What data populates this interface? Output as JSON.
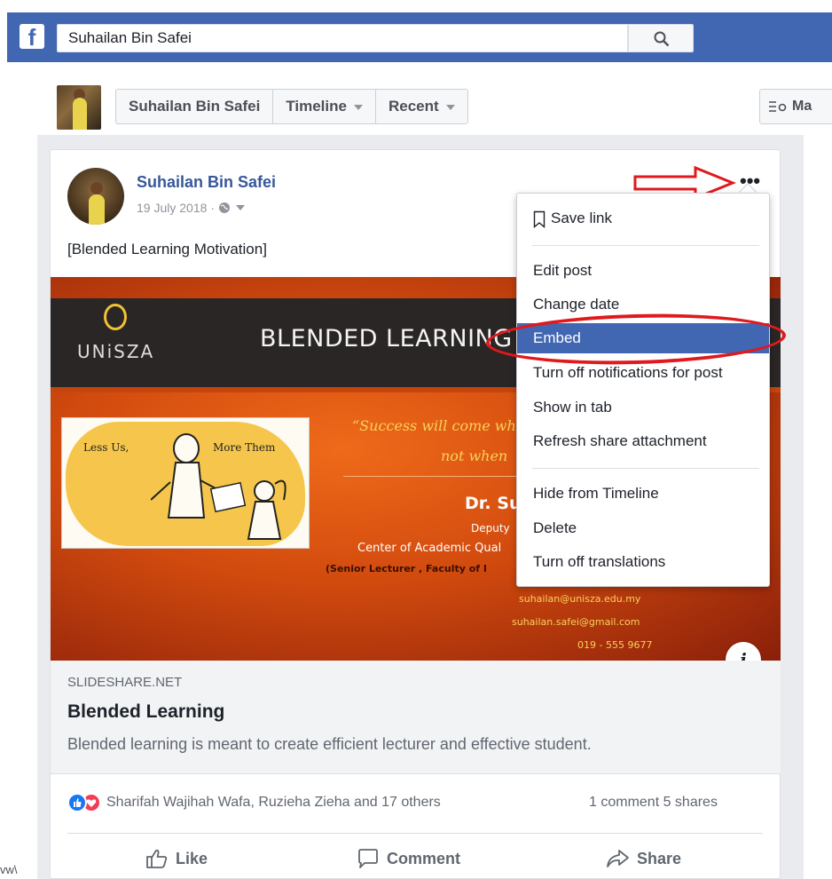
{
  "header": {
    "logo": "f",
    "search_value": "Suhailan Bin Safei",
    "search_icon": "search-icon"
  },
  "subbar": {
    "pills": [
      "Suhailan Bin Safei",
      "Timeline",
      "Recent"
    ],
    "manage_label": "Ma"
  },
  "post": {
    "author": "Suhailan Bin Safei",
    "date": "19 July 2018",
    "meta_separator": "·",
    "text": "[Blended Learning Motivation]",
    "more_icon": "•••"
  },
  "slide": {
    "logo_text": "UNiSZA",
    "title": "BLENDED LEARNING",
    "illus_left": "Less Us,",
    "illus_right": "More Them",
    "quote_line1": "“Success will come whe",
    "quote_line2": "not when",
    "speaker": "Dr. Su",
    "role": "Deputy",
    "center": "Center of Academic Qual",
    "senior": "(Senior Lecturer , Faculty of I",
    "email1": "suhailan@unisza.edu.my",
    "email2": "suhailan.safei@gmail.com",
    "phone": "019 - 555 9677",
    "info_label": "i"
  },
  "link": {
    "domain": "SLIDESHARE.NET",
    "title": "Blended Learning",
    "description": "Blended learning is meant to create efficient lecturer and effective student."
  },
  "engagement": {
    "reactors": "Sharifah Wajihah Wafa, Ruzieha Zieha and 17 others",
    "comments_shares": "1 comment  5 shares"
  },
  "actions": {
    "like": "Like",
    "comment": "Comment",
    "share": "Share"
  },
  "side_text": "vw\\",
  "menu": {
    "save_link": "Save link",
    "edit_post": "Edit post",
    "change_date": "Change date",
    "embed": "Embed",
    "turn_off_notifications": "Turn off notifications for post",
    "show_in_tab": "Show in tab",
    "refresh_share": "Refresh share attachment",
    "hide_from_timeline": "Hide from Timeline",
    "delete": "Delete",
    "turn_off_translations": "Turn off translations"
  },
  "colors": {
    "facebook_blue": "#4267b2",
    "link_blue": "#365899",
    "annotation_red": "#e0191d"
  }
}
